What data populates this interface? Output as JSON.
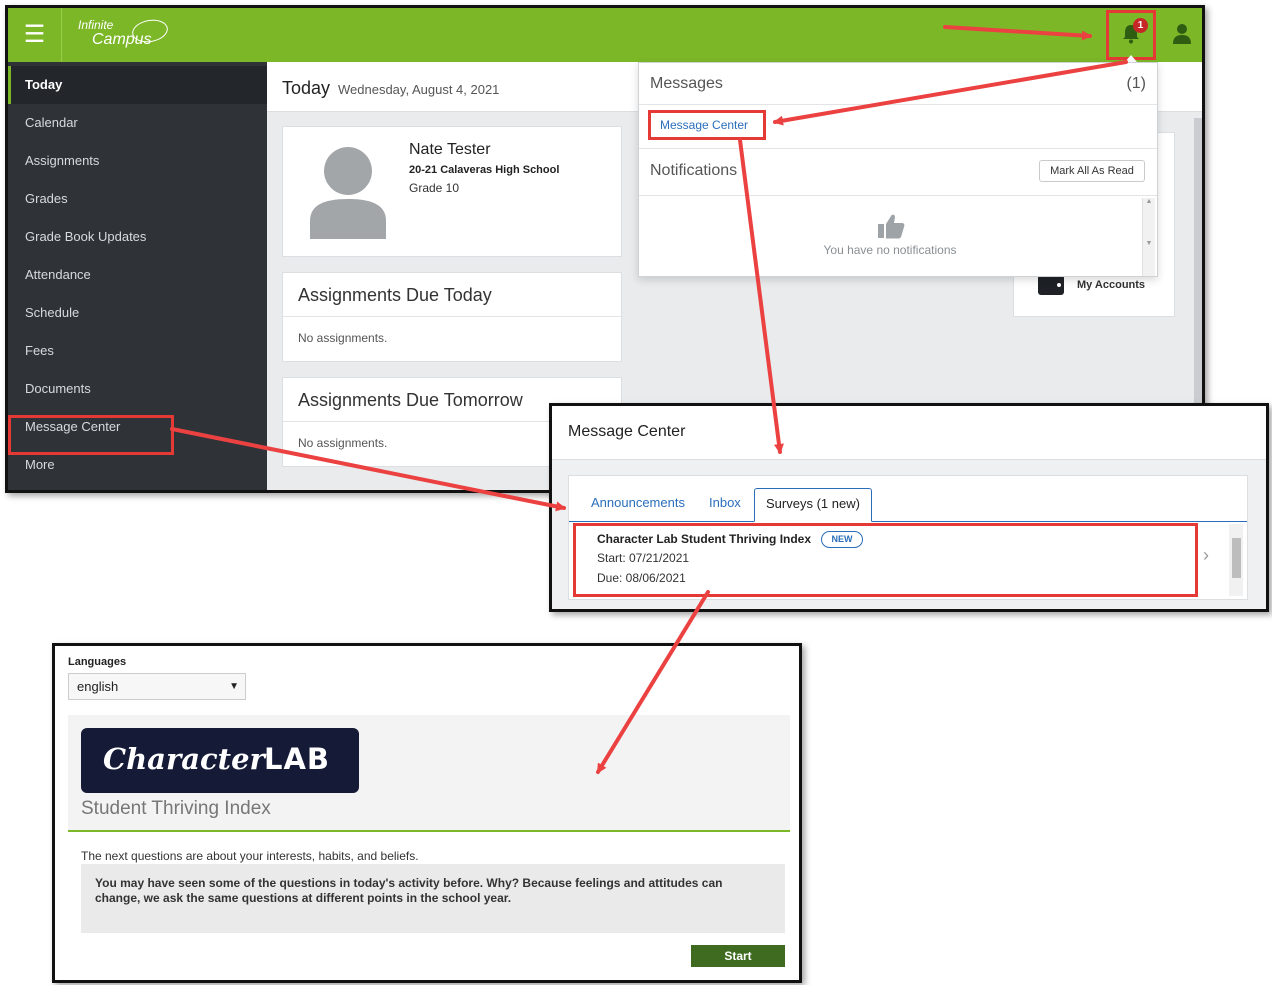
{
  "portal": {
    "logo": {
      "line1": "Infinite",
      "line2": "Campus"
    },
    "notification_badge": "1",
    "sidebar": {
      "items": [
        {
          "label": "Today"
        },
        {
          "label": "Calendar"
        },
        {
          "label": "Assignments"
        },
        {
          "label": "Grades"
        },
        {
          "label": "Grade Book Updates"
        },
        {
          "label": "Attendance"
        },
        {
          "label": "Schedule"
        },
        {
          "label": "Fees"
        },
        {
          "label": "Documents"
        },
        {
          "label": "Message Center"
        },
        {
          "label": "More"
        }
      ],
      "active": "Today",
      "highlighted": "Message Center"
    },
    "header": {
      "title": "Today",
      "date": "Wednesday, August 4, 2021"
    },
    "profile": {
      "name": "Nate Tester",
      "school": "20-21 Calaveras High School",
      "grade": "Grade 10"
    },
    "assignments_today": {
      "title": "Assignments Due Today",
      "body": "No assignments."
    },
    "assignments_tomorrow": {
      "title": "Assignments Due Tomorrow",
      "body": "No assignments."
    },
    "my_accounts": {
      "label": "My Accounts"
    },
    "dropdown": {
      "messages_label": "Messages",
      "messages_count": "(1)",
      "message_center_link": "Message Center",
      "notifications_label": "Notifications",
      "mark_all_read": "Mark All As Read",
      "empty_text": "You have no notifications"
    },
    "icons": [
      "menu-icon",
      "bell-icon",
      "user-icon",
      "avatar-icon",
      "thumbs-up-icon",
      "wallet-icon"
    ]
  },
  "message_center": {
    "title": "Message Center",
    "tabs": [
      {
        "label": "Announcements"
      },
      {
        "label": "Inbox"
      },
      {
        "label": "Surveys (1 new)"
      }
    ],
    "active_tab": "Surveys (1 new)",
    "survey": {
      "title": "Character Lab Student Thriving Index",
      "badge": "NEW",
      "start": "Start: 07/21/2021",
      "due": "Due: 08/06/2021"
    }
  },
  "survey_page": {
    "languages_label": "Languages",
    "language_value": "english",
    "logo": {
      "word1": "Character",
      "word2": "LAB"
    },
    "subtitle": "Student Thriving Index",
    "intro": "The next questions are about your interests, habits, and beliefs.",
    "notice": "You may have seen some of the questions in today's activity before. Why? Because feelings and attitudes can change, we ask the same questions at different points in the school year.",
    "start_button": "Start"
  },
  "colors": {
    "brand_green": "#7cb728",
    "sidebar_dark": "#2f3338",
    "highlight_red": "#e53935",
    "link_blue": "#2a6ebb",
    "start_green": "#3e6b1f",
    "logo_navy": "#151a37"
  }
}
